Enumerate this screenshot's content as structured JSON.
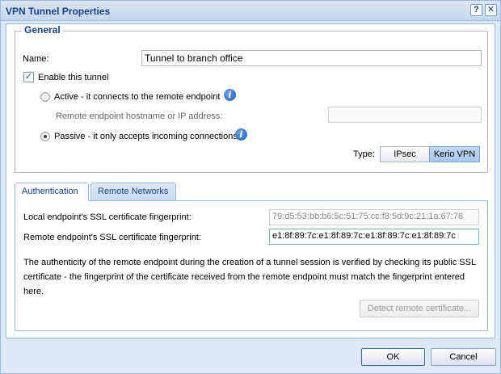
{
  "window": {
    "title": "VPN Tunnel Properties",
    "help_glyph": "?",
    "close_glyph": "✕"
  },
  "general": {
    "legend": "General",
    "name_label": "Name:",
    "name_value": "Tunnel to branch office",
    "enable_label": "Enable this tunnel",
    "enable_checked": true,
    "active_label": "Active - it connects to the remote endpoint",
    "remote_host_label": "Remote endpoint hostname or IP address:",
    "remote_host_value": "",
    "passive_label": "Passive - it only accepts incoming connections",
    "selected_mode": "passive",
    "type_label": "Type:",
    "type_options": [
      "IPsec",
      "Kerio VPN"
    ],
    "type_selected": "Kerio VPN",
    "info_glyph": "i"
  },
  "tabs": {
    "items": [
      "Authentication",
      "Remote Networks"
    ],
    "selected": "Authentication"
  },
  "auth": {
    "local_label": "Local endpoint's SSL certificate fingerprint:",
    "local_value": "79:d5:53:bb:b6:5c:51:75:cc:f8:5d:9c:21:1a:67:78",
    "remote_label": "Remote endpoint's SSL certificate fingerprint:",
    "remote_value": "e1:8f:89:7c:e1:8f:89:7c:e1:8f:89:7c:e1:8f:89:7c",
    "description": "The authenticity of the remote endpoint during the creation of a tunnel session is verified by checking its public SSL certificate - the fingerprint of the certificate received from the remote endpoint must match the fingerprint entered here.",
    "detect_button": "Detect remote certificate..."
  },
  "footer": {
    "ok_label": "OK",
    "cancel_label": "Cancel"
  },
  "colors": {
    "title_text": "#15428b",
    "dialog_bg": "#dfe8f6",
    "border": "#99bbe8"
  }
}
